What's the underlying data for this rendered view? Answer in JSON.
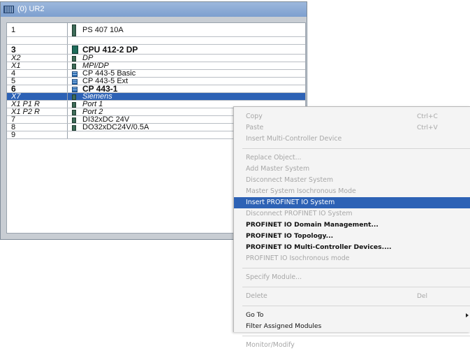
{
  "rack": {
    "title": "(0) UR2",
    "rows": [
      {
        "slot": "1",
        "module": "PS 407 10A",
        "icon": "ps",
        "italic": false,
        "bold": false,
        "selected": false
      },
      {
        "slot": "3",
        "module": "CPU 412-2 DP",
        "icon": "cpu",
        "italic": false,
        "bold": true,
        "selected": false
      },
      {
        "slot": "X2",
        "module": "DP",
        "icon": "sub",
        "italic": true,
        "bold": false,
        "selected": false
      },
      {
        "slot": "X1",
        "module": "MPI/DP",
        "icon": "sub",
        "italic": true,
        "bold": false,
        "selected": false
      },
      {
        "slot": "4",
        "module": "CP 443-5 Basic",
        "icon": "cp",
        "italic": false,
        "bold": false,
        "selected": false
      },
      {
        "slot": "5",
        "module": "CP 443-5 Ext",
        "icon": "cp",
        "italic": false,
        "bold": false,
        "selected": false
      },
      {
        "slot": "6",
        "module": "CP 443-1",
        "icon": "cp",
        "italic": false,
        "bold": true,
        "selected": false
      },
      {
        "slot": "X7",
        "module": "Siemens",
        "icon": "sub",
        "italic": true,
        "bold": false,
        "selected": true
      },
      {
        "slot": "X1 P1 R",
        "module": "Port 1",
        "icon": "sub",
        "italic": true,
        "bold": false,
        "selected": false
      },
      {
        "slot": "X1 P2 R",
        "module": "Port 2",
        "icon": "sub",
        "italic": true,
        "bold": false,
        "selected": false
      },
      {
        "slot": "7",
        "module": "DI32xDC 24V",
        "icon": "sub",
        "italic": false,
        "bold": false,
        "selected": false
      },
      {
        "slot": "8",
        "module": "DO32xDC24V/0.5A",
        "icon": "sub",
        "italic": false,
        "bold": false,
        "selected": false
      },
      {
        "slot": "9",
        "module": "",
        "icon": "none",
        "italic": false,
        "bold": false,
        "selected": false
      }
    ]
  },
  "context_menu": {
    "items": [
      {
        "label": "Copy",
        "shortcut": "Ctrl+C",
        "state": "disabled"
      },
      {
        "label": "Paste",
        "shortcut": "Ctrl+V",
        "state": "disabled"
      },
      {
        "label": "Insert Multi-Controller Device",
        "shortcut": "",
        "state": "disabled"
      },
      {
        "sep": true
      },
      {
        "label": "Replace Object...",
        "shortcut": "",
        "state": "disabled"
      },
      {
        "label": "Add Master System",
        "shortcut": "",
        "state": "disabled"
      },
      {
        "label": "Disconnect Master System",
        "shortcut": "",
        "state": "disabled"
      },
      {
        "label": "Master System Isochronous Mode",
        "shortcut": "",
        "state": "disabled"
      },
      {
        "label": "Insert PROFINET IO System",
        "shortcut": "",
        "state": "highlighted"
      },
      {
        "label": "Disconnect PROFINET IO System",
        "shortcut": "",
        "state": "disabled"
      },
      {
        "label": "PROFINET IO Domain Management...",
        "shortcut": "",
        "state": "enabled"
      },
      {
        "label": "PROFINET IO Topology...",
        "shortcut": "",
        "state": "enabled"
      },
      {
        "label": "PROFINET IO Multi-Controller Devices....",
        "shortcut": "",
        "state": "enabled"
      },
      {
        "label": "PROFINET IO Isochronous mode",
        "shortcut": "",
        "state": "disabled"
      },
      {
        "sep": true
      },
      {
        "label": "Specify Module...",
        "shortcut": "",
        "state": "disabled"
      },
      {
        "sep": true
      },
      {
        "label": "Delete",
        "shortcut": "Del",
        "state": "disabled"
      },
      {
        "sep": true
      },
      {
        "label": "Go To",
        "shortcut": "",
        "state": "enabled",
        "submenu": true
      },
      {
        "label": "Filter Assigned Modules",
        "shortcut": "",
        "state": "enabled"
      },
      {
        "sep": true
      },
      {
        "label": "Monitor/Modify",
        "shortcut": "",
        "state": "disabled"
      }
    ]
  },
  "colors": {
    "selection": "#2d62b5",
    "disabled_text": "#a7a7a7",
    "menu_bg": "#f4f4f4"
  }
}
